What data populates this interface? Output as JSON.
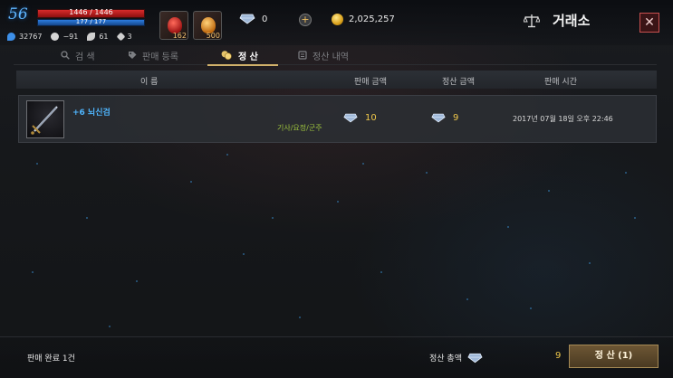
{
  "player": {
    "level": "56",
    "hp_text": "1446 / 1446",
    "hp_fraction": 1.0,
    "mp_text": "177 / 177",
    "mp_fraction": 1.0,
    "stats": [
      {
        "icon": "blue-flame-icon",
        "value": "32767"
      },
      {
        "icon": "skull-icon",
        "value": "−91"
      },
      {
        "icon": "wing-icon",
        "value": "61"
      },
      {
        "icon": "crest-icon",
        "value": "3"
      }
    ]
  },
  "consumables": [
    {
      "icon": "health-potion-icon",
      "count": "162"
    },
    {
      "icon": "orange-potion-icon",
      "count": "500"
    }
  ],
  "currency": {
    "diamond_icon": "diamond-icon",
    "diamond": "0",
    "gold_icon": "gold-coin-icon",
    "gold": "2,025,257"
  },
  "header": {
    "title": "거래소",
    "title_icon": "scales-icon",
    "close_label": "✕"
  },
  "tabs": [
    {
      "label": "검 색",
      "icon": "search-icon",
      "active": false
    },
    {
      "label": "판매 등록",
      "icon": "tag-icon",
      "active": false
    },
    {
      "label": "정 산",
      "icon": "coins-icon",
      "active": true
    },
    {
      "label": "정산 내역",
      "icon": "history-icon",
      "active": false
    }
  ],
  "table": {
    "columns": [
      "이 름",
      "판매 금액",
      "정산 금액",
      "판매 시간"
    ],
    "rows": [
      {
        "item_icon": "sword-icon",
        "name": "+6 뇌신검",
        "classes": "기사/요정/군주",
        "sale_price": "10",
        "settle_amount": "9",
        "sale_time": "2017년 07월 18일 오후 22:46"
      }
    ]
  },
  "footer": {
    "sold_count": "판매 완료 1건",
    "total_label": "정산 총액",
    "total_value": "9",
    "settle_button": "정 산 (1)"
  },
  "colors": {
    "accent_gold": "#f0c84a",
    "item_name": "#4fb6ff",
    "class_text": "#9cc23d",
    "hp": "#d82b2b",
    "mp": "#2d7de0"
  }
}
